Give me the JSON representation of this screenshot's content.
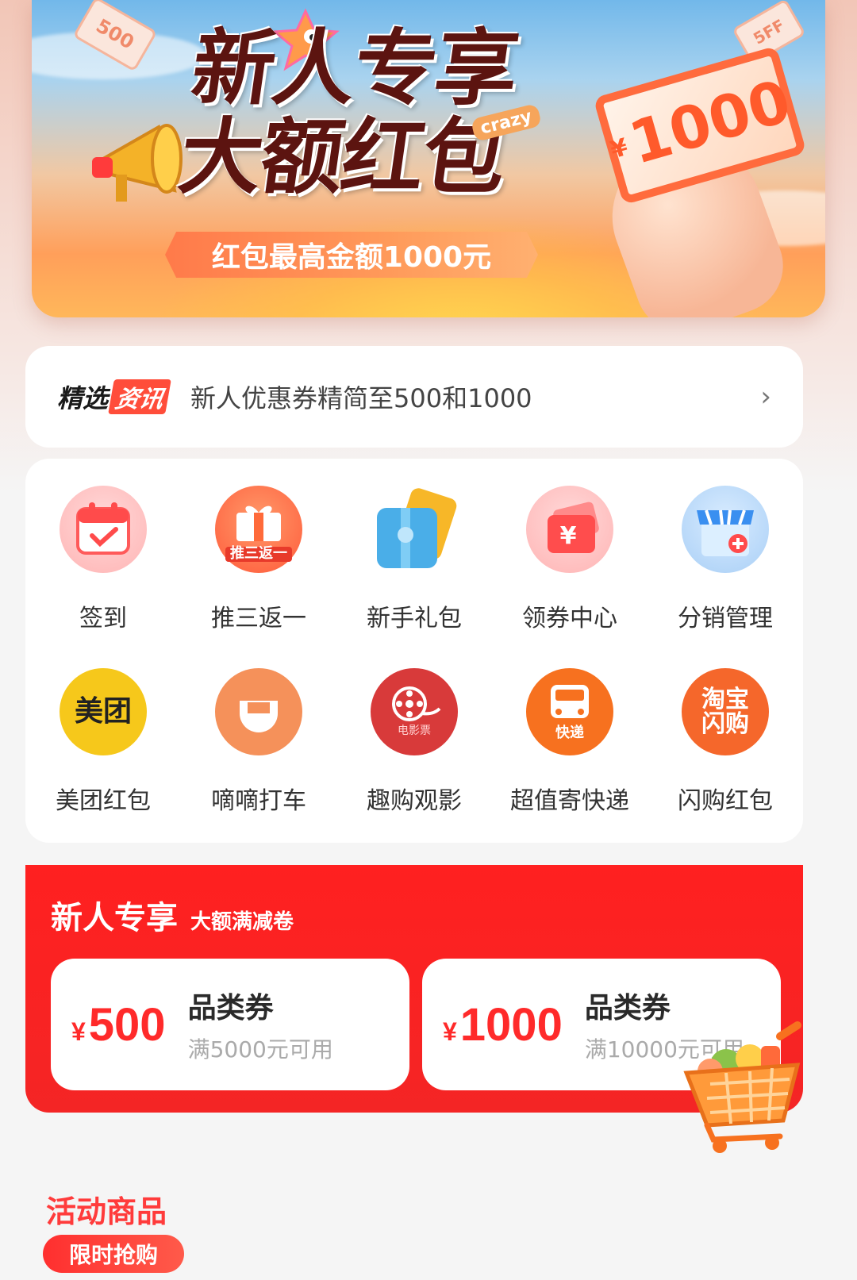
{
  "banner": {
    "headline_1": "新人专享",
    "headline_2": "大额红包",
    "crazy": "crazy",
    "subline": "红包最高金额1000元",
    "bill_currency": "¥",
    "bill_amount": "1000",
    "ticket_left": "500",
    "ticket_right": "5FF"
  },
  "news": {
    "brand_1": "精选",
    "brand_2": "资讯",
    "text": "新人优惠券精简至500和1000",
    "chevron": "›"
  },
  "grid": [
    {
      "label": "签到",
      "icon": "calendar-check-icon"
    },
    {
      "label": "推三返一",
      "icon": "gift-box-icon",
      "badge": "推三返一"
    },
    {
      "label": "新手礼包",
      "icon": "gift-card-icon"
    },
    {
      "label": "领券中心",
      "icon": "coupon-yen-icon",
      "glyph": "¥"
    },
    {
      "label": "分销管理",
      "icon": "store-icon"
    },
    {
      "label": "美团红包",
      "icon": "meituan-icon",
      "glyph": "美团"
    },
    {
      "label": "嘀嘀打车",
      "icon": "didi-icon"
    },
    {
      "label": "趣购观影",
      "icon": "film-reel-icon",
      "glyph": "电影票"
    },
    {
      "label": "超值寄快递",
      "icon": "delivery-truck-icon",
      "glyph": "快递"
    },
    {
      "label": "闪购红包",
      "icon": "taobao-flash-icon",
      "glyph_1": "淘宝",
      "glyph_2": "闪购"
    }
  ],
  "coupons": {
    "title": "新人专享",
    "subtitle": "大额满减卷",
    "items": [
      {
        "currency": "¥",
        "amount": "500",
        "type": "品类券",
        "condition": "满5000元可用"
      },
      {
        "currency": "¥",
        "amount": "1000",
        "type": "品类券",
        "condition": "满10000元可用"
      }
    ]
  },
  "activity": {
    "title": "活动商品",
    "tag": "限时抢购"
  },
  "colors": {
    "accent_red": "#ff2020",
    "brand_dark": "#5c1410",
    "meituan_yellow": "#f6c81b"
  }
}
